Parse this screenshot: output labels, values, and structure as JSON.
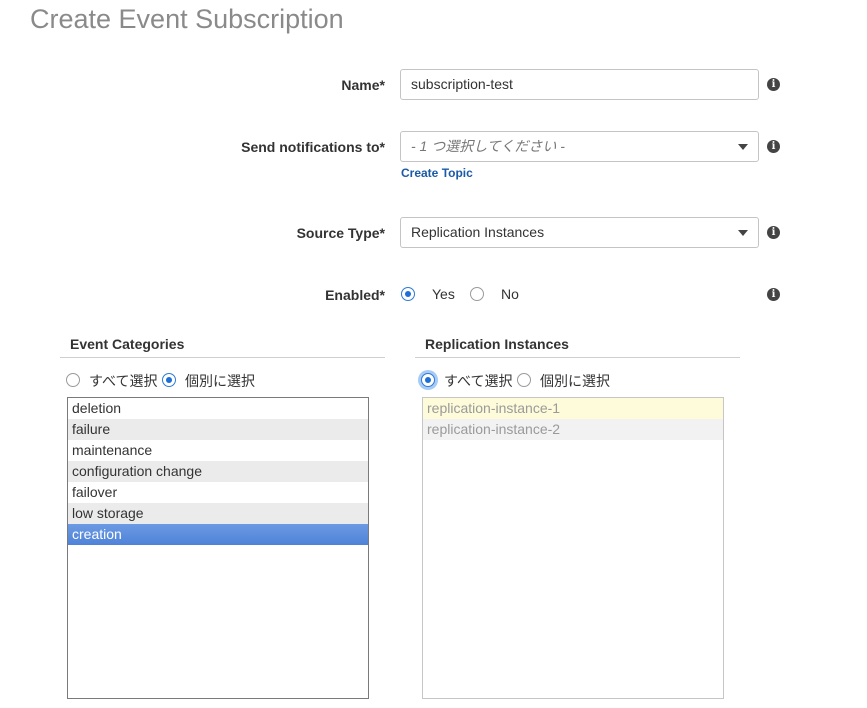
{
  "page": {
    "title": "Create Event Subscription"
  },
  "form": {
    "name": {
      "label": "Name*",
      "value": "subscription-test"
    },
    "send_notifications": {
      "label": "Send notifications to*",
      "placeholder": "- 1 つ選択してください -",
      "link": "Create Topic"
    },
    "source_type": {
      "label": "Source Type*",
      "value": "Replication Instances"
    },
    "enabled": {
      "label": "Enabled*",
      "options": [
        "Yes",
        "No"
      ],
      "selected": "Yes"
    },
    "info_icon": "i"
  },
  "event_categories": {
    "heading": "Event Categories",
    "options": [
      "すべて選択",
      "個別に選択"
    ],
    "selected_option": "個別に選択",
    "items": [
      "deletion",
      "failure",
      "maintenance",
      "configuration change",
      "failover",
      "low storage",
      "creation"
    ],
    "selected_item": "creation"
  },
  "replication_instances": {
    "heading": "Replication Instances",
    "options": [
      "すべて選択",
      "個別に選択"
    ],
    "selected_option": "すべて選択",
    "items": [
      "replication-instance-1",
      "replication-instance-2"
    ]
  },
  "colors": {
    "accent": "#1d6ed6",
    "link": "#1a5aa6",
    "selection": "#5b8ede"
  }
}
